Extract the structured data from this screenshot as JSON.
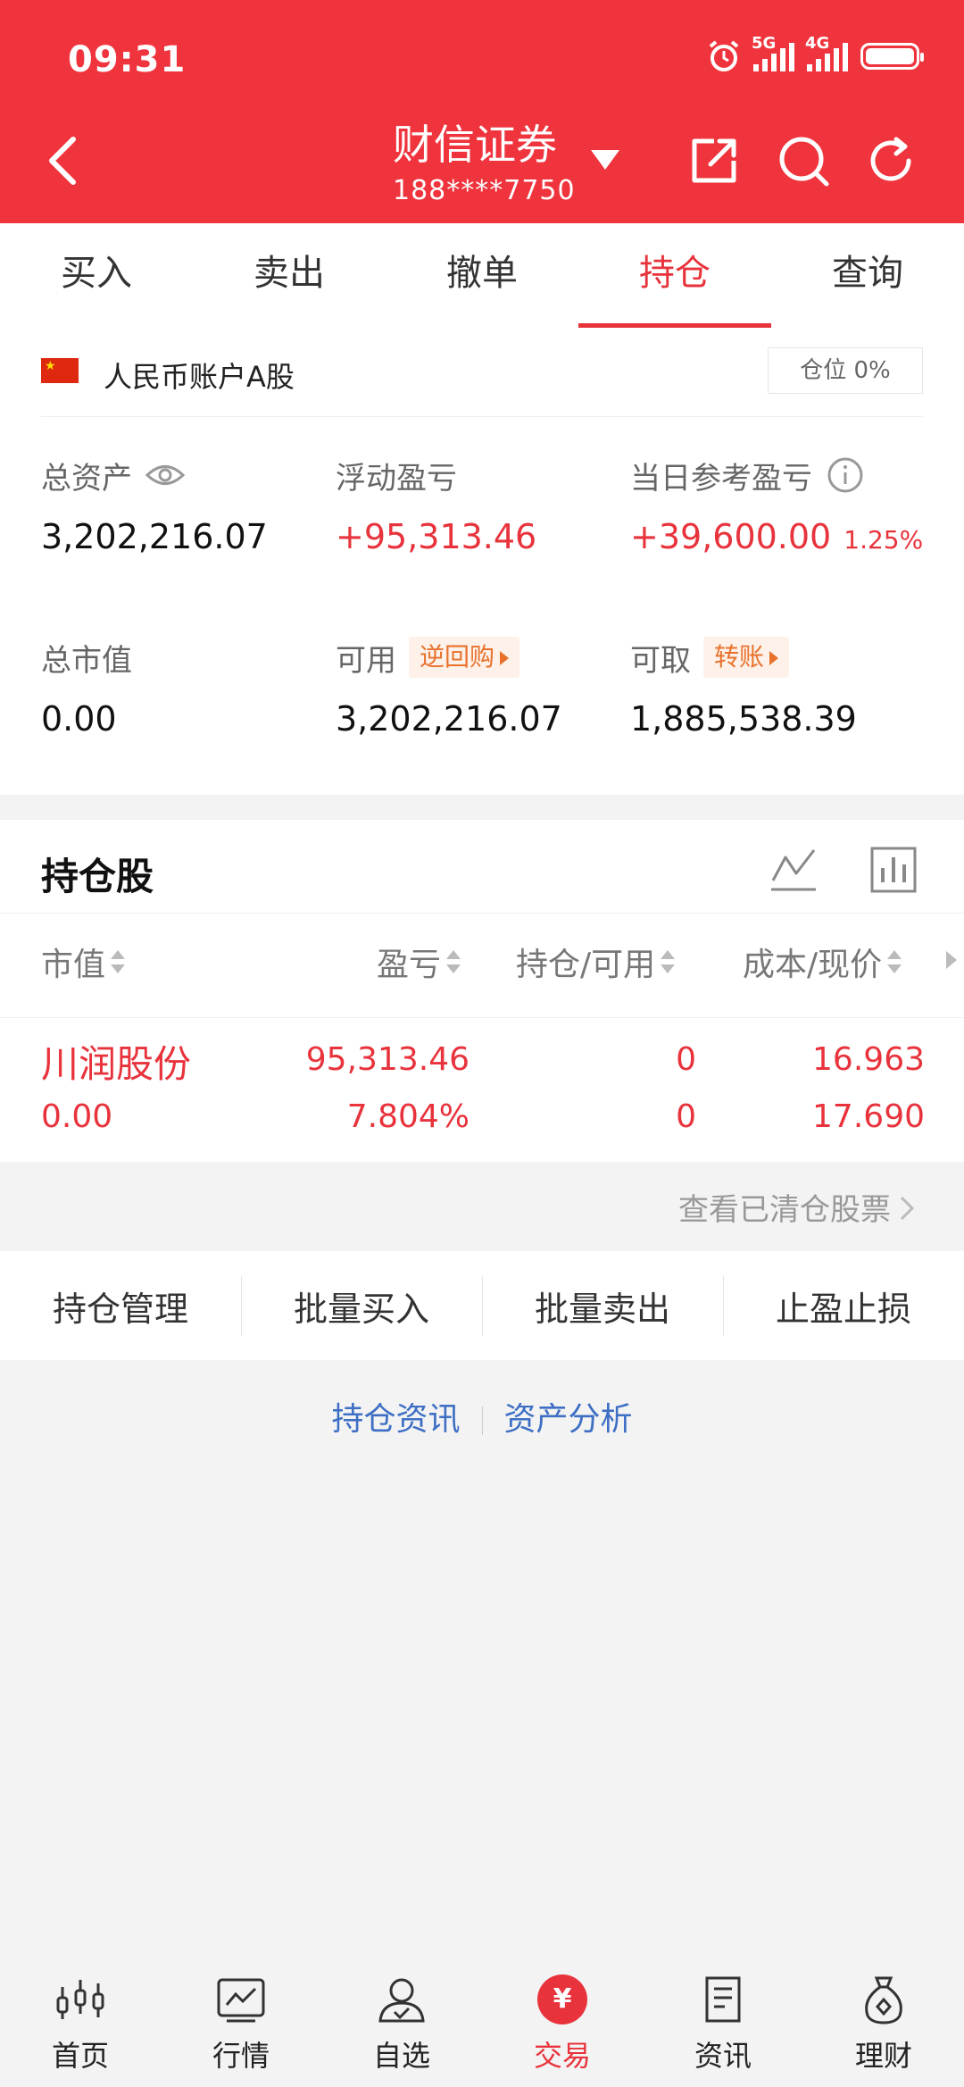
{
  "status": {
    "time": "09:31",
    "net1": "5G",
    "net2": "4G"
  },
  "header": {
    "title": "财信证券",
    "account": "188****7750"
  },
  "tabs": [
    {
      "label": "买入"
    },
    {
      "label": "卖出"
    },
    {
      "label": "撤单"
    },
    {
      "label": "持仓",
      "active": true
    },
    {
      "label": "查询"
    }
  ],
  "account": {
    "type": "人民币账户A股",
    "position_ratio": "仓位 0%",
    "total_assets_label": "总资产",
    "total_assets": "3,202,216.07",
    "floating_pl_label": "浮动盈亏",
    "floating_pl": "+95,313.46",
    "daily_pl_label": "当日参考盈亏",
    "daily_pl": "+39,600.00",
    "daily_pl_pct": "1.25%",
    "market_value_label": "总市值",
    "market_value": "0.00",
    "available_label": "可用",
    "available_tag": "逆回购",
    "available": "3,202,216.07",
    "withdrawable_label": "可取",
    "withdrawable_tag": "转账",
    "withdrawable": "1,885,538.39"
  },
  "holdings": {
    "title": "持仓股",
    "columns": [
      "市值",
      "盈亏",
      "持仓/可用",
      "成本/现价"
    ],
    "rows": [
      {
        "name": "川润股份",
        "market_value": "0.00",
        "pl": "95,313.46",
        "pl_pct": "7.804%",
        "position": "0",
        "available": "0",
        "cost": "16.963",
        "price": "17.690"
      }
    ],
    "cleared_link": "查看已清仓股票"
  },
  "actions": [
    "持仓管理",
    "批量买入",
    "批量卖出",
    "止盈止损"
  ],
  "links": [
    "持仓资讯",
    "资产分析"
  ],
  "nav": [
    {
      "label": "首页",
      "icon": "candlestick-icon"
    },
    {
      "label": "行情",
      "icon": "market-chart-icon"
    },
    {
      "label": "自选",
      "icon": "user-check-icon"
    },
    {
      "label": "交易",
      "icon": "yuan-icon",
      "active": true,
      "glyph": "¥"
    },
    {
      "label": "资讯",
      "icon": "document-icon"
    },
    {
      "label": "理财",
      "icon": "money-bag-icon"
    }
  ],
  "colors": {
    "brand": "#f0343d",
    "accent": "#e8333c",
    "tag": "#e8722c",
    "link": "#3e6fc4"
  }
}
